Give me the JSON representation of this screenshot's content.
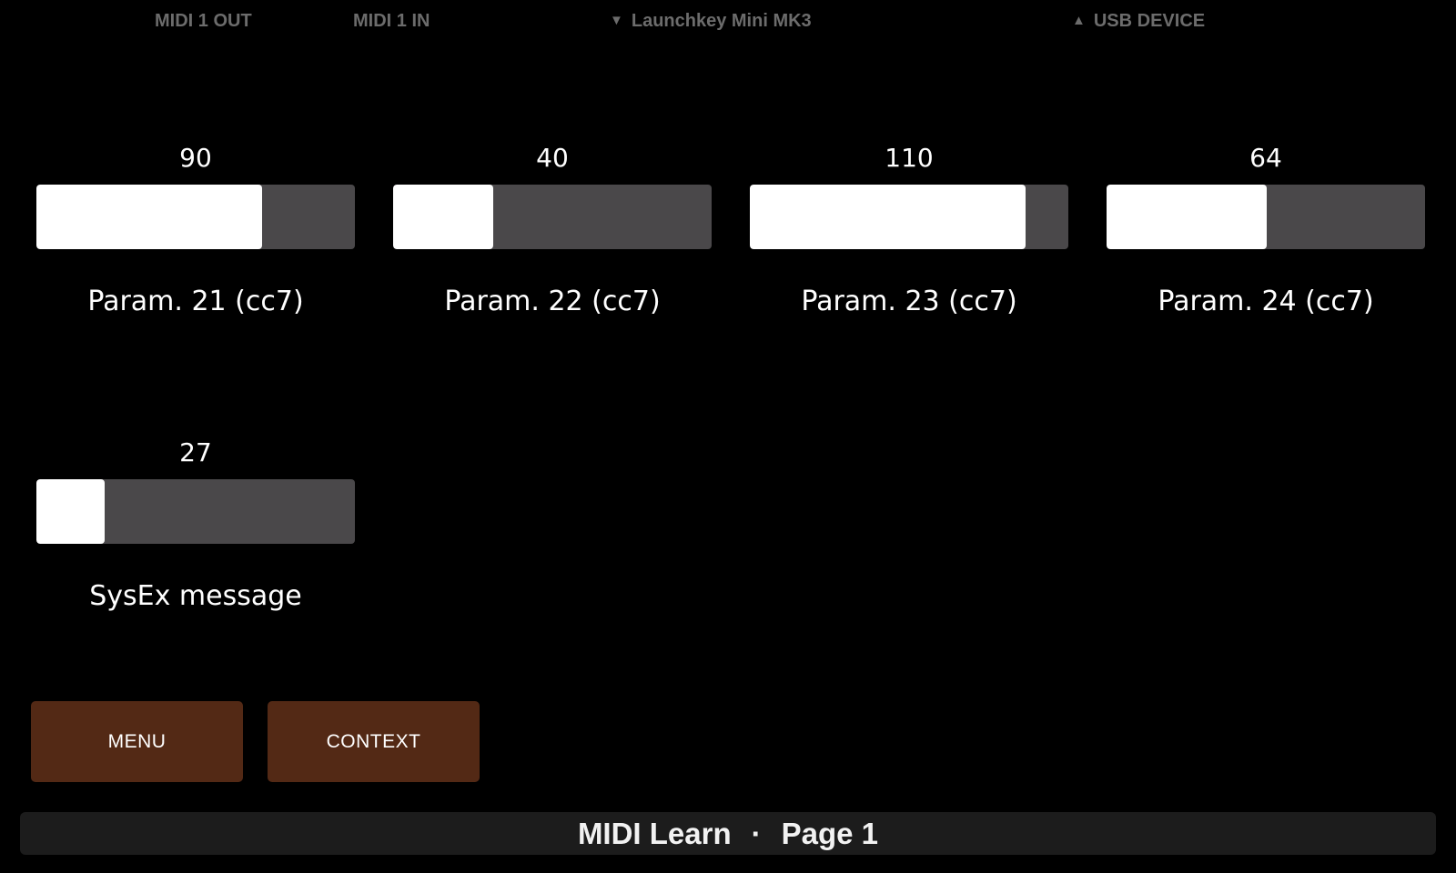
{
  "status_bar": {
    "midi_out": "MIDI 1 OUT",
    "midi_in": "MIDI 1 IN",
    "device": {
      "icon": "triangle-down-icon",
      "glyph": "▼",
      "label": "Launchkey Mini MK3"
    },
    "usb": {
      "icon": "triangle-up-icon",
      "glyph": "▲",
      "label": "USB DEVICE"
    }
  },
  "params": [
    {
      "value": "90",
      "fraction": 0.709,
      "label": "Param. 21 (cc7)"
    },
    {
      "value": "40",
      "fraction": 0.315,
      "label": "Param. 22 (cc7)"
    },
    {
      "value": "110",
      "fraction": 0.866,
      "label": "Param. 23 (cc7)"
    },
    {
      "value": "64",
      "fraction": 0.504,
      "label": "Param. 24 (cc7)"
    },
    {
      "value": "27",
      "fraction": 0.213,
      "label": "SysEx message"
    }
  ],
  "buttons": {
    "menu_label": "MENU",
    "context_label": "CONTEXT"
  },
  "footer": {
    "mode": "MIDI Learn",
    "separator": "·",
    "page": "Page 1"
  },
  "colors": {
    "background": "#000000",
    "track": "#4a484a",
    "fill": "#ffffff",
    "button": "#532915",
    "footer": "#1c1c1c",
    "status_text": "#6c6c6c"
  }
}
